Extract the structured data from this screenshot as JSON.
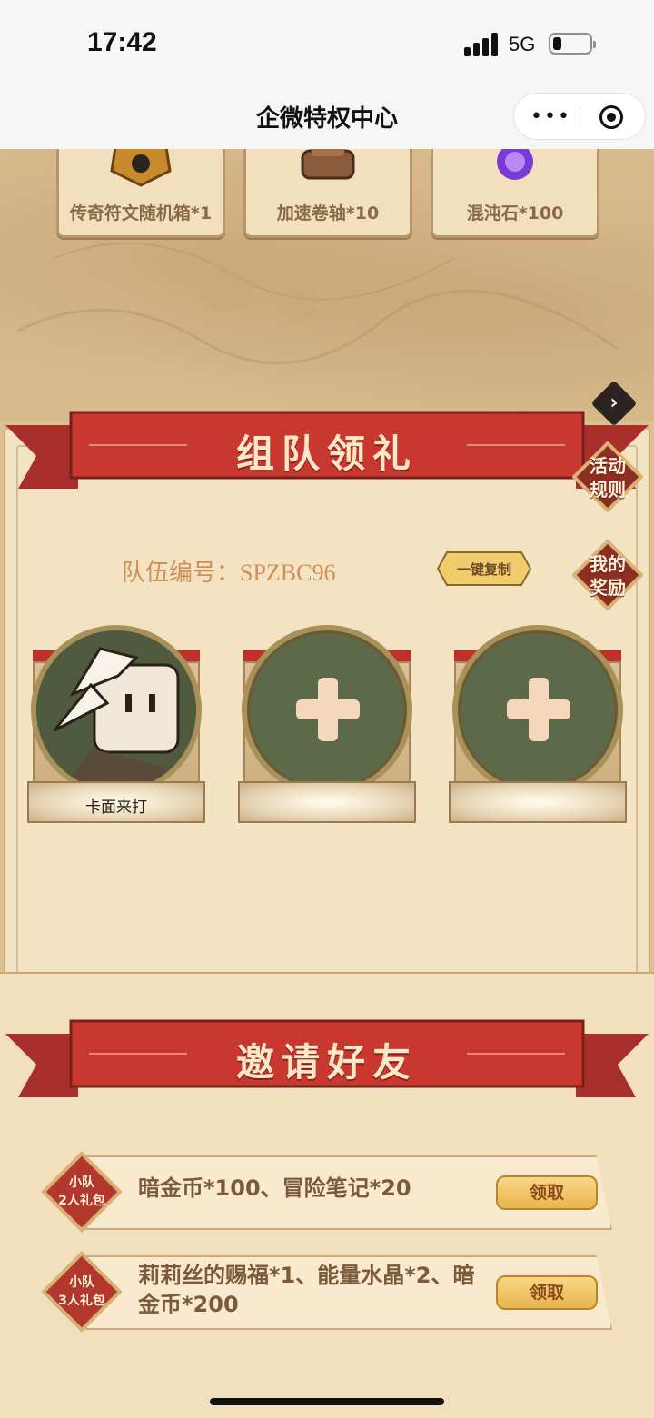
{
  "status_bar": {
    "time": "17:42",
    "network": "5G",
    "battery_level": 0.2
  },
  "nav": {
    "title": "企微特权中心",
    "more_icon": "more-dots-icon",
    "close_icon": "target-close-icon"
  },
  "rewards_top": [
    {
      "label": "传奇符文随机箱*1",
      "icon": "rune-box-icon"
    },
    {
      "label": "加速卷轴*10",
      "icon": "scroll-icon"
    },
    {
      "label": "混沌石*100",
      "icon": "chaos-stone-icon"
    }
  ],
  "team": {
    "banner_title": "组队领礼",
    "rules_label": "活动\n规则",
    "my_rewards_label": "我的\n奖励",
    "team_code": "队伍编号：SPZBC96",
    "copy_label": "一键复制",
    "members": [
      {
        "name": "卡面来打",
        "state": "joined"
      },
      {
        "name": "",
        "state": "empty"
      },
      {
        "name": "",
        "state": "empty"
      }
    ]
  },
  "invite": {
    "banner_title": "邀请好友",
    "gifts": [
      {
        "badge": "小队\n2人礼包",
        "desc": "暗金币*100、冒险笔记*20",
        "button": "领取"
      },
      {
        "badge": "小队\n3人礼包",
        "desc": "莉莉丝的赐福*1、能量水晶*2、暗金币*200",
        "button": "领取"
      }
    ]
  },
  "colors": {
    "banner_red": "#c0302b",
    "panel_bg": "#f3e3c2",
    "accent_gold": "#e9b54d",
    "code_text": "#d08f56"
  }
}
